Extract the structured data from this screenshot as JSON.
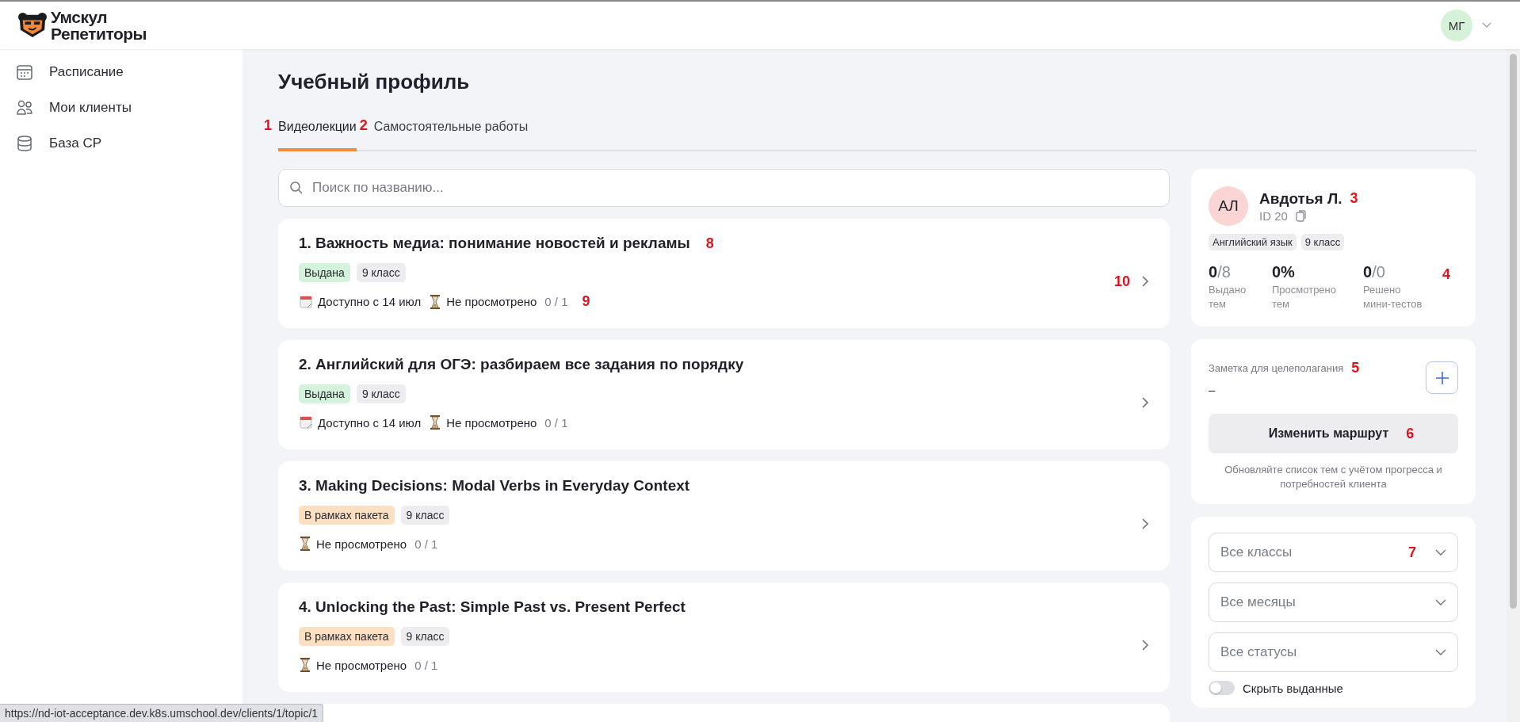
{
  "header": {
    "logo_line_1": "Умскул",
    "logo_line_2": "Репетиторы",
    "avatar_initials": "МГ"
  },
  "sidebar": {
    "items": [
      {
        "label": "Расписание",
        "kind": "calendar"
      },
      {
        "label": "Мои клиенты",
        "kind": "people"
      },
      {
        "label": "База СР",
        "kind": "database"
      }
    ]
  },
  "page_title": "Учебный профиль",
  "tabs": [
    {
      "label": "Видеолекции",
      "selected": true,
      "marker": "1"
    },
    {
      "label": "Самостоятельные работы",
      "selected": false,
      "marker": "2"
    }
  ],
  "search": {
    "placeholder": "Поиск по названию..."
  },
  "topics": [
    {
      "title": "1. Важность медиа: понимание новостей и рекламы",
      "title_marker": "8",
      "status": {
        "label": "Выдана",
        "kind": "issued"
      },
      "grade": "9 класс",
      "available": "Доступно с 14 июл",
      "progress_label": "Не просмотрено",
      "progress": "0 / 1",
      "meta_marker": "9",
      "arrow_marker": "10"
    },
    {
      "title": "2. Английский для ОГЭ: разбираем все задания по порядку",
      "status": {
        "label": "Выдана",
        "kind": "issued"
      },
      "grade": "9 класс",
      "available": "Доступно с 14 июл",
      "progress_label": "Не просмотрено",
      "progress": "0 / 1"
    },
    {
      "title": "3. Making Decisions: Modal Verbs in Everyday Context",
      "status": {
        "label": "В рамках пакета",
        "kind": "package"
      },
      "grade": "9 класс",
      "progress_label": "Не просмотрено",
      "progress": "0 / 1"
    },
    {
      "title": "4. Unlocking the Past: Simple Past vs. Present Perfect",
      "status": {
        "label": "В рамках пакета",
        "kind": "package"
      },
      "grade": "9 класс",
      "progress_label": "Не просмотрено",
      "progress": "0 / 1"
    }
  ],
  "profile": {
    "initials": "АЛ",
    "name": "Авдотья Л.",
    "name_marker": "3",
    "id": "ID 20",
    "tags": [
      "Английский язык",
      "9 класс"
    ],
    "stats_marker": "4",
    "stats": [
      {
        "value": "0",
        "rest": "/8",
        "label": "Выдано тем"
      },
      {
        "value": "0%",
        "label": "Просмотрено тем"
      },
      {
        "value": "0",
        "rest": "/0",
        "label": "Решено мини-тестов"
      }
    ]
  },
  "note": {
    "label": "Заметка для целеполагания",
    "marker": "5",
    "value": "–",
    "button": "Изменить маршрут",
    "button_marker": "6",
    "hint": "Обновляйте список тем с учётом прогресса и потребностей клиента"
  },
  "filters": [
    {
      "placeholder": "Все классы",
      "marker": "7"
    },
    {
      "placeholder": "Все месяцы"
    },
    {
      "placeholder": "Все статусы"
    }
  ],
  "toggle": {
    "label": "Скрыть выданные",
    "on": false
  },
  "status_bar": {
    "url": "https://nd-iot-acceptance.dev.k8s.umschool.dev/clients/1/topic/1"
  }
}
